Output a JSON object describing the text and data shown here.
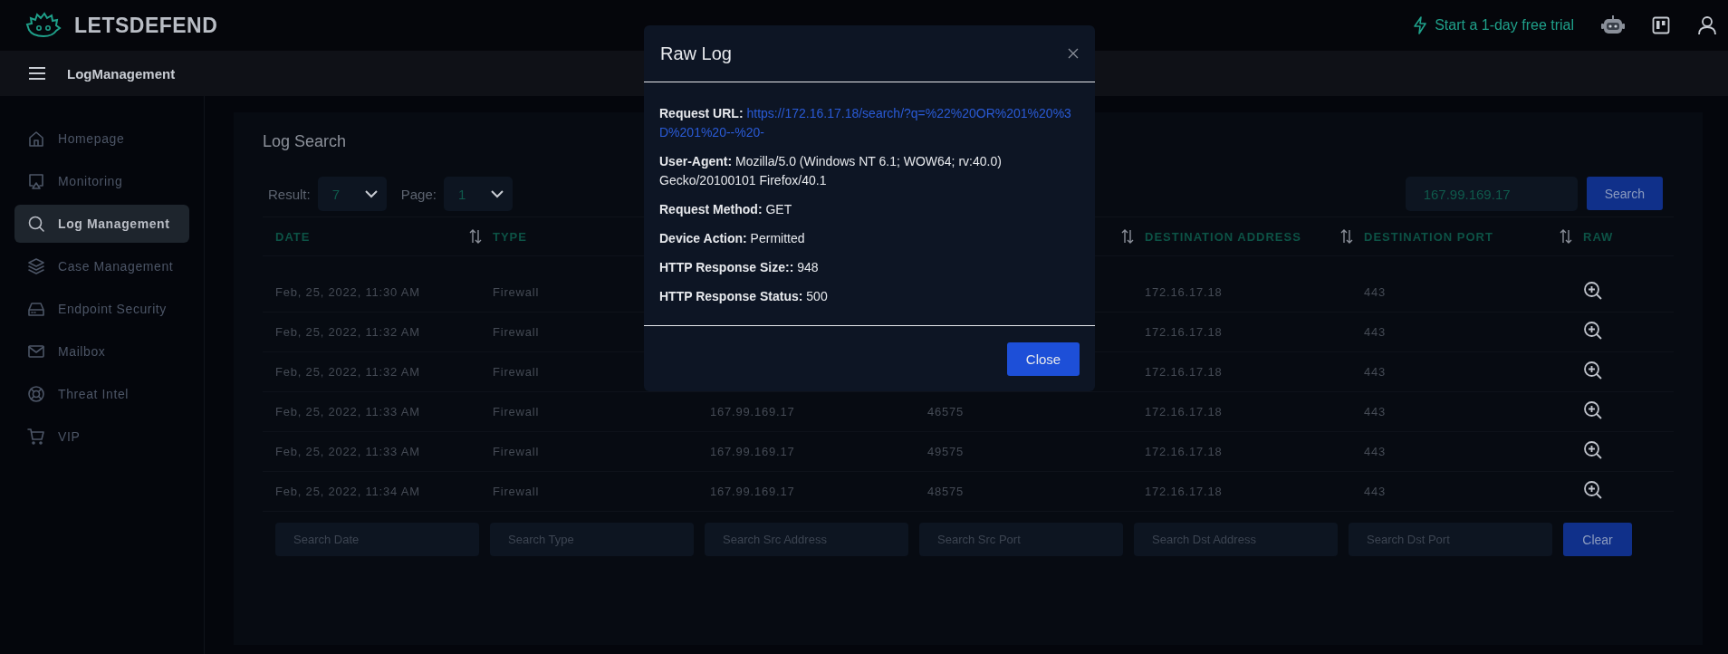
{
  "brand": {
    "name": "LETSDEFEND"
  },
  "top_actions": {
    "trial": "Start a 1-day free trial"
  },
  "breadcrumb": {
    "title": "LogManagement"
  },
  "sidebar": {
    "items": [
      {
        "label": "Homepage",
        "selected": false
      },
      {
        "label": "Monitoring",
        "selected": false
      },
      {
        "label": "Log Management",
        "selected": true
      },
      {
        "label": "Case Management",
        "selected": false
      },
      {
        "label": "Endpoint Security",
        "selected": false
      },
      {
        "label": "Mailbox",
        "selected": false
      },
      {
        "label": "Threat Intel",
        "selected": false
      },
      {
        "label": "VIP",
        "selected": false
      }
    ]
  },
  "log_search": {
    "title": "Log Search",
    "result": {
      "label": "Result:",
      "value": "7"
    },
    "page": {
      "label": "Page:",
      "value": "1"
    },
    "search": {
      "value": "167.99.169.17",
      "button": "Search"
    },
    "columns": [
      {
        "label": "DATE",
        "sort_icon": true
      },
      {
        "label": "TYPE",
        "sort_icon": false
      },
      {},
      {
        "sort_icon": true
      },
      {
        "label": "DESTINATION ADDRESS",
        "sort_icon": true
      },
      {
        "label": "DESTINATION PORT",
        "sort_icon": true
      },
      {
        "label": "RAW",
        "sort_icon": false
      }
    ],
    "rows": [
      {
        "date": "Feb, 25, 2022, 11:30 AM",
        "type": "Firewall",
        "dst_address": "172.16.17.18",
        "dst_port": "443"
      },
      {
        "date": "Feb, 25, 2022, 11:32 AM",
        "type": "Firewall",
        "dst_address": "172.16.17.18",
        "dst_port": "443"
      },
      {
        "date": "Feb, 25, 2022, 11:32 AM",
        "type": "Firewall",
        "dst_address": "172.16.17.18",
        "dst_port": "443"
      },
      {
        "date": "Feb, 25, 2022, 11:33 AM",
        "type": "Firewall",
        "src_address": "167.99.169.17",
        "src_port": "46575",
        "dst_address": "172.16.17.18",
        "dst_port": "443"
      },
      {
        "date": "Feb, 25, 2022, 11:33 AM",
        "type": "Firewall",
        "src_address": "167.99.169.17",
        "src_port": "49575",
        "dst_address": "172.16.17.18",
        "dst_port": "443"
      },
      {
        "date": "Feb, 25, 2022, 11:34 AM",
        "type": "Firewall",
        "src_address": "167.99.169.17",
        "src_port": "48575",
        "dst_address": "172.16.17.18",
        "dst_port": "443"
      }
    ],
    "filters": [
      {
        "placeholder": "Search Date"
      },
      {
        "placeholder": "Search Type"
      },
      {
        "placeholder": "Search Src Address"
      },
      {
        "placeholder": "Search Src Port"
      },
      {
        "placeholder": "Search Dst Address"
      },
      {
        "placeholder": "Search Dst Port"
      }
    ],
    "clear_button": "Clear"
  },
  "modal": {
    "title": "Raw Log",
    "fields": [
      {
        "label": "Request URL:",
        "value": "https://172.16.17.18/search/?q=%22%20OR%201%20%3D%201%20--%20-",
        "kind": "link"
      },
      {
        "label": "User-Agent:",
        "value": "Mozilla/5.0 (Windows NT 6.1; WOW64; rv:40.0) Gecko/20100101 Firefox/40.1",
        "kind": "text"
      },
      {
        "label": "Request Method:",
        "value": "GET",
        "kind": "text"
      },
      {
        "label": "Device Action:",
        "value": "Permitted",
        "kind": "text"
      },
      {
        "label": "HTTP Response Size::",
        "value": "948",
        "kind": "text"
      },
      {
        "label": "HTTP Response Status:",
        "value": "500",
        "kind": "text"
      }
    ],
    "button": "Close"
  }
}
